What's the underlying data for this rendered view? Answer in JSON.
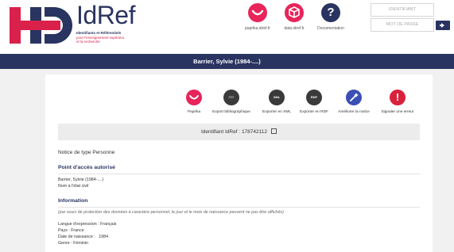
{
  "brand": {
    "name": "IdRef",
    "tagline_line1": "Identifiants et Référentiels",
    "tagline_line2": "pour l'enseignement supérieur",
    "tagline_line3": "et la recherche",
    "colors": {
      "navy": "#2a3460",
      "red": "#d9214b"
    }
  },
  "top_links": [
    {
      "label": "paprika.idref.fr",
      "icon": "paprika-icon",
      "color": "#e8245a"
    },
    {
      "label": "data.idref.fr",
      "icon": "data-cube-icon",
      "color": "#e8245a"
    },
    {
      "label": "Documentation",
      "icon": "help-icon",
      "color": "#2a3460"
    }
  ],
  "login": {
    "identifiant_placeholder": "IDENTIFIANT",
    "password_placeholder": "MOT DE PASSE",
    "submit_icon": "login-arrow-icon"
  },
  "page_title": "Barrier, Sylvie (1984-....)",
  "tools": [
    {
      "label": "Paprika",
      "icon": "paprika-icon",
      "icon_text": "",
      "color": "#e8245a"
    },
    {
      "label": "Export bibliographique",
      "icon": "export-biblio-icon",
      "icon_text": "≡≡≡",
      "color": "#3a3a3a"
    },
    {
      "label": "Exporter en XML",
      "icon": "xml-icon",
      "icon_text": "XML",
      "color": "#3a3a3a"
    },
    {
      "label": "Exporter en RDF",
      "icon": "rdf-icon",
      "icon_text": "RDF",
      "color": "#3a3a3a"
    },
    {
      "label": "Améliorer la notice",
      "icon": "magic-wand-icon",
      "icon_text": "",
      "color": "#3a4fb5"
    },
    {
      "label": "Signaler une erreur",
      "icon": "alert-icon",
      "icon_text": "!",
      "color": "#d9213b"
    }
  ],
  "identifier": "Identifiant IdRef : 178742112",
  "notice_type": "Notice de type Personne",
  "sections": {
    "access_point": {
      "title": "Point d'accès autorisé",
      "lines": [
        "Barrier, Sylvie (1984-....)",
        "Nom à l'état civil"
      ]
    },
    "information": {
      "title": "Information",
      "note": "(par souci de protection des données à caractère personnel, le jour et le mois de naissance peuvent ne pas être affichés)",
      "lines": [
        "Langue d'expression : Français",
        "Pays : France",
        "Date de naissance :   1984",
        "Genre : Féminin"
      ]
    }
  }
}
